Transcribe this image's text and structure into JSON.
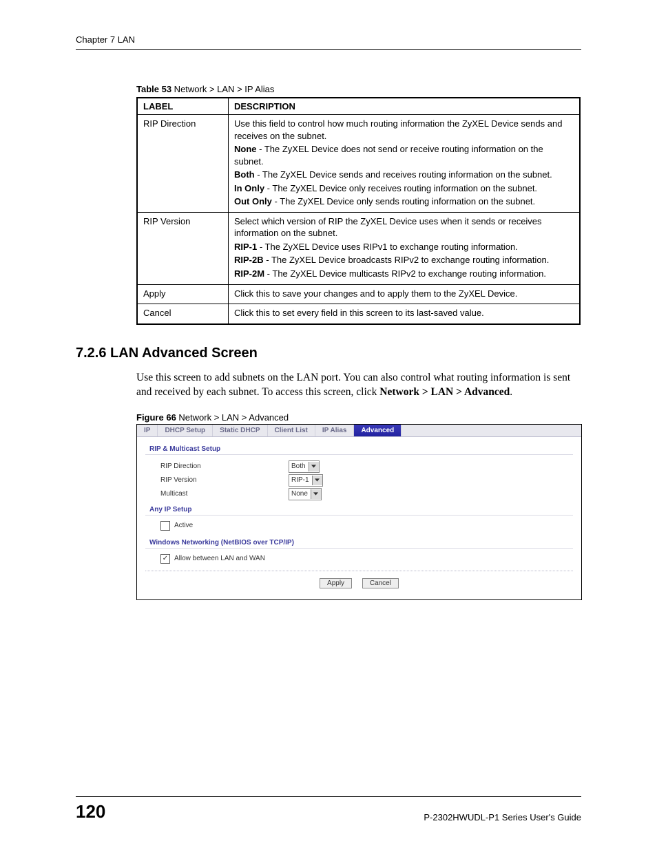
{
  "header": "Chapter 7 LAN",
  "table": {
    "caption_bold": "Table 53",
    "caption_rest": "   Network > LAN > IP Alias",
    "head_label": "LABEL",
    "head_desc": "DESCRIPTION",
    "rows": [
      {
        "label": "RIP Direction",
        "lines": [
          {
            "prefix": "",
            "text": "Use this field to control how much routing information the ZyXEL Device sends and receives on the subnet."
          },
          {
            "prefix": "None",
            "text": " - The ZyXEL Device does not send or receive routing information on the subnet."
          },
          {
            "prefix": "Both",
            "text": " - The ZyXEL Device sends and receives routing information on the subnet."
          },
          {
            "prefix": "In Only",
            "text": " - The ZyXEL Device only receives routing information on the subnet."
          },
          {
            "prefix": "Out Only",
            "text": " - The ZyXEL Device only sends routing information on the subnet."
          }
        ]
      },
      {
        "label": "RIP Version",
        "lines": [
          {
            "prefix": "",
            "text": "Select which version of RIP the ZyXEL Device uses when it sends or receives information on the subnet."
          },
          {
            "prefix": "RIP-1",
            "text": " - The ZyXEL Device uses RIPv1 to exchange routing information."
          },
          {
            "prefix": "RIP-2B",
            "text": " - The ZyXEL Device broadcasts RIPv2 to exchange routing information."
          },
          {
            "prefix": "RIP-2M",
            "text": " - The ZyXEL Device multicasts RIPv2 to exchange routing information."
          }
        ]
      },
      {
        "label": "Apply",
        "lines": [
          {
            "prefix": "",
            "text": "Click this to save your changes and to apply them to the ZyXEL Device."
          }
        ]
      },
      {
        "label": "Cancel",
        "lines": [
          {
            "prefix": "",
            "text": "Click this to set every field in this screen to its last-saved value."
          }
        ]
      }
    ]
  },
  "section": {
    "heading": "7.2.6  LAN Advanced Screen",
    "para_pre": "Use this screen to add subnets on the LAN port. You can also control what routing information is sent and received by each subnet. To access this screen, click ",
    "para_bold": "Network > LAN > Advanced",
    "para_post": "."
  },
  "figure": {
    "caption_bold": "Figure 66",
    "caption_rest": "   Network > LAN > Advanced",
    "tabs": [
      "IP",
      "DHCP Setup",
      "Static DHCP",
      "Client List",
      "IP Alias",
      "Advanced"
    ],
    "active_tab_index": 5,
    "sec1_title": "RIP & Multicast Setup",
    "row1_label": "RIP Direction",
    "row1_value": "Both",
    "row2_label": "RIP Version",
    "row2_value": "RIP-1",
    "row3_label": "Multicast",
    "row3_value": "None",
    "sec2_title": "Any IP Setup",
    "cb_active_label": "Active",
    "cb_active_checked": false,
    "sec3_title": "Windows Networking (NetBIOS over TCP/IP)",
    "cb_allow_label": "Allow between LAN and WAN",
    "cb_allow_checked": true,
    "btn_apply": "Apply",
    "btn_cancel": "Cancel"
  },
  "footer": {
    "page_number": "120",
    "guide": "P-2302HWUDL-P1 Series User's Guide"
  }
}
